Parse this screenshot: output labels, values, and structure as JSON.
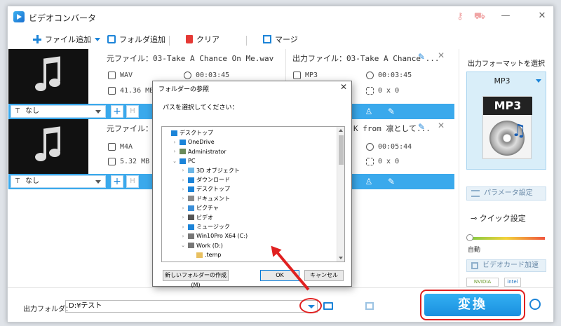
{
  "app": {
    "title": "ビデオコンバータ"
  },
  "toolbar": {
    "add_file": "ファイル追加",
    "add_folder": "フォルダ追加",
    "clear": "クリア",
    "merge": "マージ"
  },
  "items": [
    {
      "source_label": "元ファイル：03-Take A Chance On Me.wav",
      "src_format": "WAV",
      "src_duration": "00:03:45",
      "src_size": "41.36 MB",
      "output_label": "出力ファイル：03-Take A Chance ...",
      "out_format": "MP3",
      "out_duration": "00:03:45",
      "out_resolution": "0 x 0",
      "subtitle": "なし"
    },
    {
      "source_label": "元ファイル：",
      "src_format": "M4A",
      "src_size": "5.32 MB",
      "output_label": "K from 凛として...",
      "out_duration": "00:05:44",
      "out_resolution": "0 x 0",
      "subtitle": "なし"
    }
  ],
  "right_panel": {
    "header": "出力フォーマットを選択",
    "format": "MP3",
    "format_icon_text": "MP3",
    "param_label": "パラメータ設定",
    "quick_label": "クイック設定",
    "auto_label": "自動",
    "gpu_label": "ビデオカード加速",
    "gpu_chips": [
      "NVIDIA",
      "intel"
    ]
  },
  "bottom": {
    "output_folder_label": "出力フォルダ：",
    "output_path": "D:¥テスト",
    "convert_label": "変換"
  },
  "dialog": {
    "title": "フォルダーの参照",
    "prompt": "パスを選択してください：",
    "tree": [
      {
        "label": "デスクトップ",
        "indent": 0,
        "chev": "",
        "icon": "desktop"
      },
      {
        "label": "OneDrive",
        "indent": 1,
        "chev": ">",
        "icon": "cloud"
      },
      {
        "label": "Administrator",
        "indent": 1,
        "chev": ">",
        "icon": "user"
      },
      {
        "label": "PC",
        "indent": 1,
        "chev": "v",
        "icon": "pc"
      },
      {
        "label": "3D オブジェクト",
        "indent": 2,
        "chev": ">",
        "icon": "cube"
      },
      {
        "label": "ダウンロード",
        "indent": 2,
        "chev": ">",
        "icon": "download"
      },
      {
        "label": "デスクトップ",
        "indent": 2,
        "chev": ">",
        "icon": "desktop"
      },
      {
        "label": "ドキュメント",
        "indent": 2,
        "chev": ">",
        "icon": "doc"
      },
      {
        "label": "ピクチャ",
        "indent": 2,
        "chev": ">",
        "icon": "picture"
      },
      {
        "label": "ビデオ",
        "indent": 2,
        "chev": ">",
        "icon": "video"
      },
      {
        "label": "ミュージック",
        "indent": 2,
        "chev": ">",
        "icon": "music"
      },
      {
        "label": "Win10Pro X64 (C:)",
        "indent": 2,
        "chev": ">",
        "icon": "drive"
      },
      {
        "label": "Work (D:)",
        "indent": 2,
        "chev": "v",
        "icon": "drive"
      },
      {
        "label": ".temp",
        "indent": 3,
        "chev": "",
        "icon": "folder"
      }
    ],
    "new_folder": "新しいフォルダーの作成(M)",
    "ok": "OK",
    "cancel": "キャンセル"
  },
  "colors": {
    "accent": "#3aa9ec",
    "annotation": "#e02020"
  }
}
